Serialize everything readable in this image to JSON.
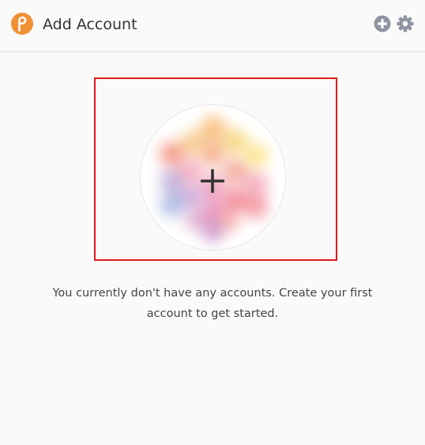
{
  "header": {
    "title": "Add Account",
    "logo_icon": "polkadot-logo-icon",
    "add_icon": "plus-circle-icon",
    "settings_icon": "gear-icon"
  },
  "main": {
    "add_account_icon": "plus-icon",
    "empty_message": "You currently don't have any accounts. Create your first account to get started."
  },
  "colors": {
    "brand_orange": "#f19135",
    "icon_gray": "#8e94a1",
    "highlight_red": "#e0181b",
    "background": "#fafafa"
  }
}
